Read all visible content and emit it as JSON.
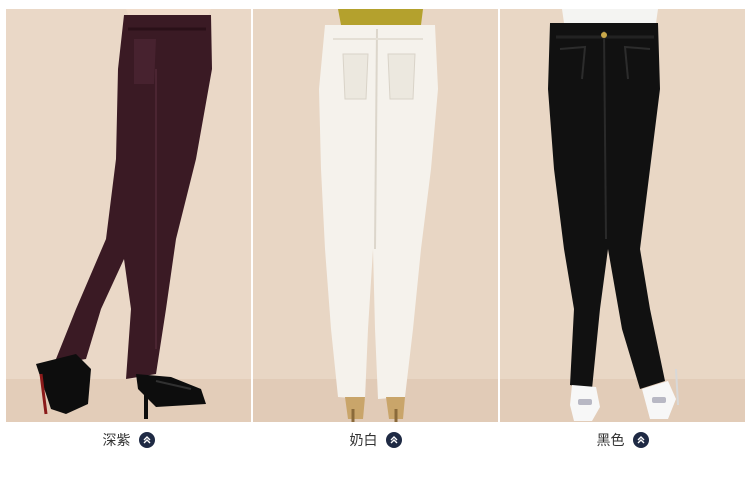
{
  "products": [
    {
      "color_name": "深紫",
      "swatch": "#3a1a24",
      "badge_icon": "double-chevron-up-icon"
    },
    {
      "color_name": "奶白",
      "swatch": "#f3f0ea",
      "badge_icon": "double-chevron-up-icon"
    },
    {
      "color_name": "黑色",
      "swatch": "#111111",
      "badge_icon": "double-chevron-up-icon"
    }
  ],
  "colors": {
    "backdrop": "#e9d7c5",
    "badge": "#1f2a44",
    "caption_text": "#333333"
  }
}
